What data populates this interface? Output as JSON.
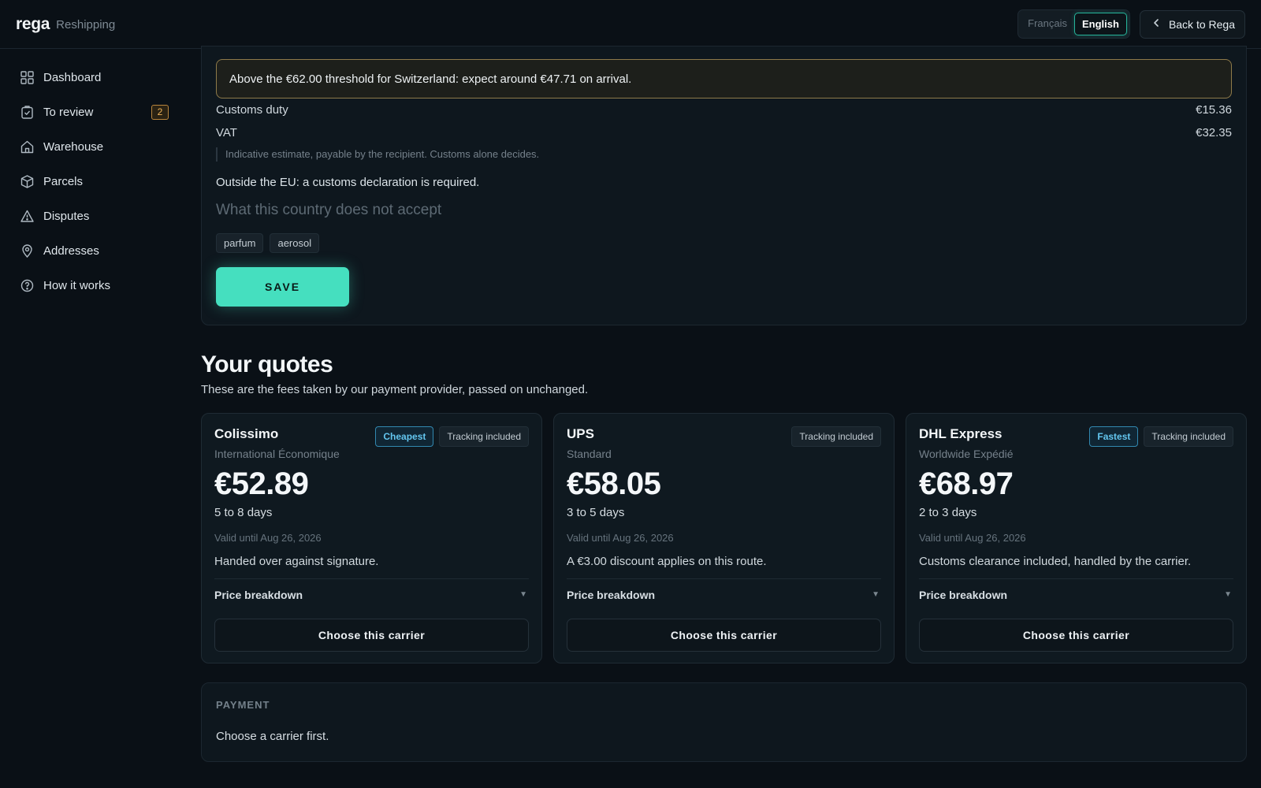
{
  "header": {
    "brand": "rega",
    "brand_sub": "Reshipping",
    "languages": [
      "Français",
      "English"
    ],
    "active_language": "English",
    "back_label": "Back to Rega"
  },
  "sidebar": {
    "items": [
      {
        "label": "Dashboard",
        "icon": "grid-icon"
      },
      {
        "label": "To review",
        "icon": "clipboard-check-icon",
        "badge": "2"
      },
      {
        "label": "Warehouse",
        "icon": "home-icon"
      },
      {
        "label": "Parcels",
        "icon": "box-icon"
      },
      {
        "label": "Disputes",
        "icon": "warning-icon"
      },
      {
        "label": "Addresses",
        "icon": "map-pin-icon"
      },
      {
        "label": "How it works",
        "icon": "help-circle-icon"
      }
    ]
  },
  "customs": {
    "threshold_notice": "Above the €62.00 threshold for Switzerland: expect around €47.71 on arrival.",
    "duty_label": "Customs duty",
    "duty_value": "€15.36",
    "vat_label": "VAT",
    "vat_value": "€32.35",
    "note": "Indicative estimate, payable by the recipient. Customs alone decides.",
    "outside_eu": "Outside the EU: a customs declaration is required.",
    "not_accept_placeholder": "What this country does not accept",
    "tags": [
      "parfum",
      "aerosol"
    ],
    "save_label": "SAVE"
  },
  "quotes": {
    "title": "Your quotes",
    "subtitle": "These are the fees taken by our payment provider, passed on unchanged.",
    "cards": [
      {
        "carrier": "Colissimo",
        "service": "International Économique",
        "pills": [
          "Cheapest",
          "Tracking included"
        ],
        "price": "€52.89",
        "days": "5 to 8 days",
        "valid": "Valid until Aug 26, 2026",
        "note": "Handed over against signature.",
        "breakdown": "Price breakdown",
        "choose": "Choose this carrier"
      },
      {
        "carrier": "UPS",
        "service": "Standard",
        "pills": [
          "Tracking included"
        ],
        "price": "€58.05",
        "days": "3 to 5 days",
        "valid": "Valid until Aug 26, 2026",
        "note": "A €3.00 discount applies on this route.",
        "breakdown": "Price breakdown",
        "choose": "Choose this carrier"
      },
      {
        "carrier": "DHL Express",
        "service": "Worldwide Expédié",
        "pills": [
          "Fastest",
          "Tracking included"
        ],
        "price": "€68.97",
        "days": "2 to 3 days",
        "valid": "Valid until Aug 26, 2026",
        "note": "Customs clearance included, handled by the carrier.",
        "breakdown": "Price breakdown",
        "choose": "Choose this carrier"
      }
    ]
  },
  "payment": {
    "label": "PAYMENT",
    "text": "Choose a carrier first."
  },
  "colors": {
    "accent": "#45dfbf",
    "background": "#0a1016",
    "badge_warning": "#f0b45a",
    "pill_highlight": "#63c6ef"
  }
}
